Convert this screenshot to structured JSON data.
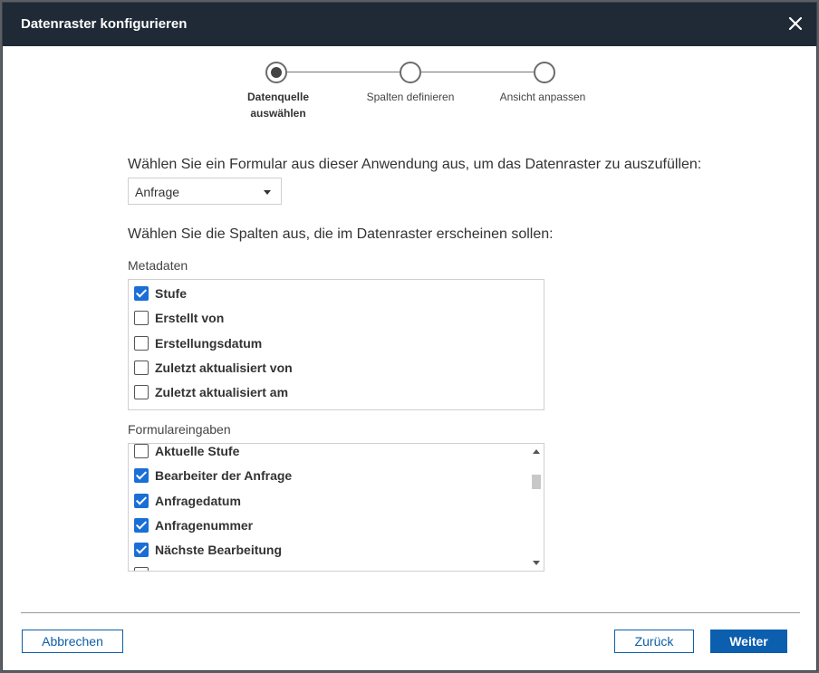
{
  "dialog": {
    "title": "Datenraster konfigurieren",
    "close_icon": "close-icon"
  },
  "stepper": {
    "steps": [
      {
        "label": "Datenquelle auswählen",
        "active": true
      },
      {
        "label": "Spalten definieren",
        "active": false
      },
      {
        "label": "Ansicht anpassen",
        "active": false
      }
    ]
  },
  "form": {
    "prompt": "Wählen Sie ein Formular aus dieser Anwendung aus, um das Datenraster zu auszufüllen:",
    "selected_form": "Anfrage"
  },
  "columns": {
    "prompt": "Wählen Sie die Spalten aus, die im Datenraster erscheinen sollen:",
    "metadata_label": "Metadaten",
    "metadata_items": [
      {
        "label": "Stufe",
        "checked": true
      },
      {
        "label": "Erstellt von",
        "checked": false
      },
      {
        "label": "Erstellungsdatum",
        "checked": false
      },
      {
        "label": "Zuletzt aktualisiert von",
        "checked": false
      },
      {
        "label": "Zuletzt aktualisiert am",
        "checked": false
      }
    ],
    "form_inputs_label": "Formulareingaben",
    "form_input_items": [
      {
        "label": "Aktuelle Stufe",
        "checked": false
      },
      {
        "label": "Bearbeiter der Anfrage",
        "checked": true
      },
      {
        "label": "Anfragedatum",
        "checked": true
      },
      {
        "label": "Anfragenummer",
        "checked": true
      },
      {
        "label": "Nächste Bearbeitung",
        "checked": true
      },
      {
        "label": "",
        "checked": false
      }
    ]
  },
  "footer": {
    "cancel_label": "Abbrechen",
    "back_label": "Zurück",
    "next_label": "Weiter"
  },
  "colors": {
    "titlebar": "#1f2a36",
    "accent": "#0b5fae",
    "checkbox": "#1a6fd6"
  }
}
